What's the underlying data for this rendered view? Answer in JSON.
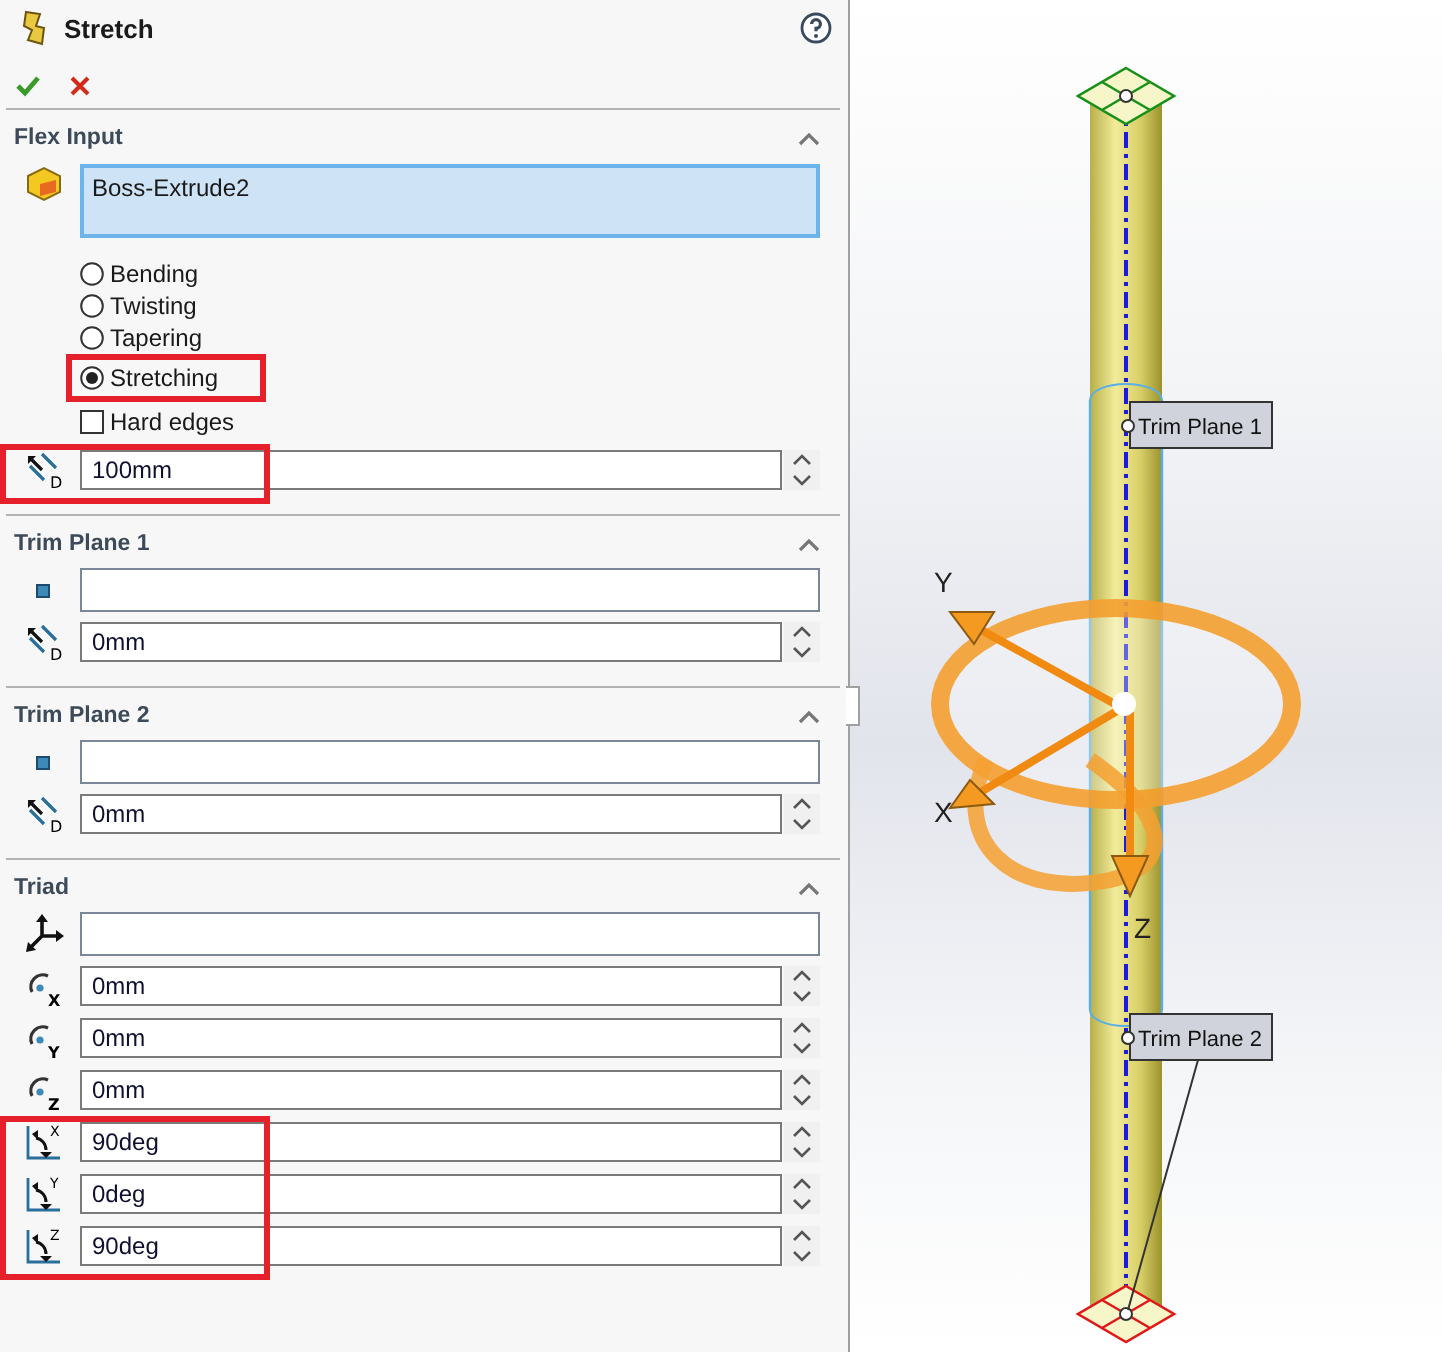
{
  "header": {
    "title": "Stretch"
  },
  "sections": [
    {
      "title": "Flex Input",
      "expanded": true,
      "selection": {
        "value": "Boss-Extrude2",
        "active": true
      },
      "options": [
        {
          "label": "Bending",
          "selected": false,
          "highlighted": false
        },
        {
          "label": "Twisting",
          "selected": false,
          "highlighted": false
        },
        {
          "label": "Tapering",
          "selected": false,
          "highlighted": false
        },
        {
          "label": "Stretching",
          "selected": true,
          "highlighted": true
        }
      ],
      "checkbox": {
        "label": "Hard edges",
        "checked": false
      },
      "groups": [
        {
          "highlighted": true,
          "rows": [
            {
              "kind": "distance",
              "icon_letter": "D",
              "value": "100mm"
            }
          ]
        }
      ]
    },
    {
      "title": "Trim Plane 1",
      "expanded": true,
      "groups": [
        {
          "highlighted": false,
          "rows": [
            {
              "kind": "plane",
              "value": ""
            },
            {
              "kind": "distance",
              "icon_letter": "D",
              "value": "0mm"
            }
          ]
        }
      ]
    },
    {
      "title": "Trim Plane 2",
      "expanded": true,
      "groups": [
        {
          "highlighted": false,
          "rows": [
            {
              "kind": "plane",
              "value": ""
            },
            {
              "kind": "distance",
              "icon_letter": "D",
              "value": "0mm"
            }
          ]
        }
      ]
    },
    {
      "title": "Triad",
      "expanded": true,
      "groups": [
        {
          "highlighted": false,
          "rows": [
            {
              "kind": "triad",
              "value": ""
            },
            {
              "kind": "translate",
              "icon_letter": "X",
              "value": "0mm"
            },
            {
              "kind": "translate",
              "icon_letter": "Y",
              "value": "0mm"
            },
            {
              "kind": "translate",
              "icon_letter": "Z",
              "value": "0mm"
            }
          ]
        },
        {
          "highlighted": true,
          "rows": [
            {
              "kind": "rotate",
              "icon_letter": "X",
              "value": "90deg"
            },
            {
              "kind": "rotate",
              "icon_letter": "Y",
              "value": "0deg"
            },
            {
              "kind": "rotate",
              "icon_letter": "Z",
              "value": "90deg"
            }
          ]
        }
      ]
    }
  ],
  "viewport": {
    "callouts": [
      "Trim Plane 1",
      "Trim Plane 2"
    ],
    "axes": [
      "Y",
      "X",
      "Z"
    ]
  }
}
